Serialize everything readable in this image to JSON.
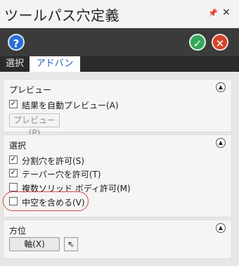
{
  "window": {
    "title": "ツールパス穴定義",
    "pin_icon": "pin-icon",
    "close_icon": "close-icon"
  },
  "toolbar": {
    "help_icon": "?",
    "ok_icon": "✓",
    "cancel_icon": "✕"
  },
  "tabs": [
    {
      "label": "選択"
    },
    {
      "label": "アドバンス",
      "active": true
    }
  ],
  "preview": {
    "title": "プレビュー",
    "auto_preview_label": "結果を自動プレビュー(A)",
    "auto_preview_checked": true,
    "preview_button_label": "プレビュー(P)"
  },
  "selection": {
    "title": "選択",
    "items": [
      {
        "label": "分割穴を許可(S)",
        "checked": true
      },
      {
        "label": "テーパー穴を許可(T)",
        "checked": true
      },
      {
        "label": "複数ソリッド ボディ許可(M)",
        "checked": false
      },
      {
        "label": "中空を含める(V)",
        "checked": false
      }
    ]
  },
  "orientation": {
    "title": "方位",
    "axis_button_label": "軸(X)"
  },
  "colors": {
    "toolbar_bg": "#3b3b3b",
    "active_tab_text": "#1f5fb4",
    "help": "#2a6fd6",
    "ok": "#35a85a",
    "cancel": "#d6422a",
    "highlight": "#d04a45"
  }
}
